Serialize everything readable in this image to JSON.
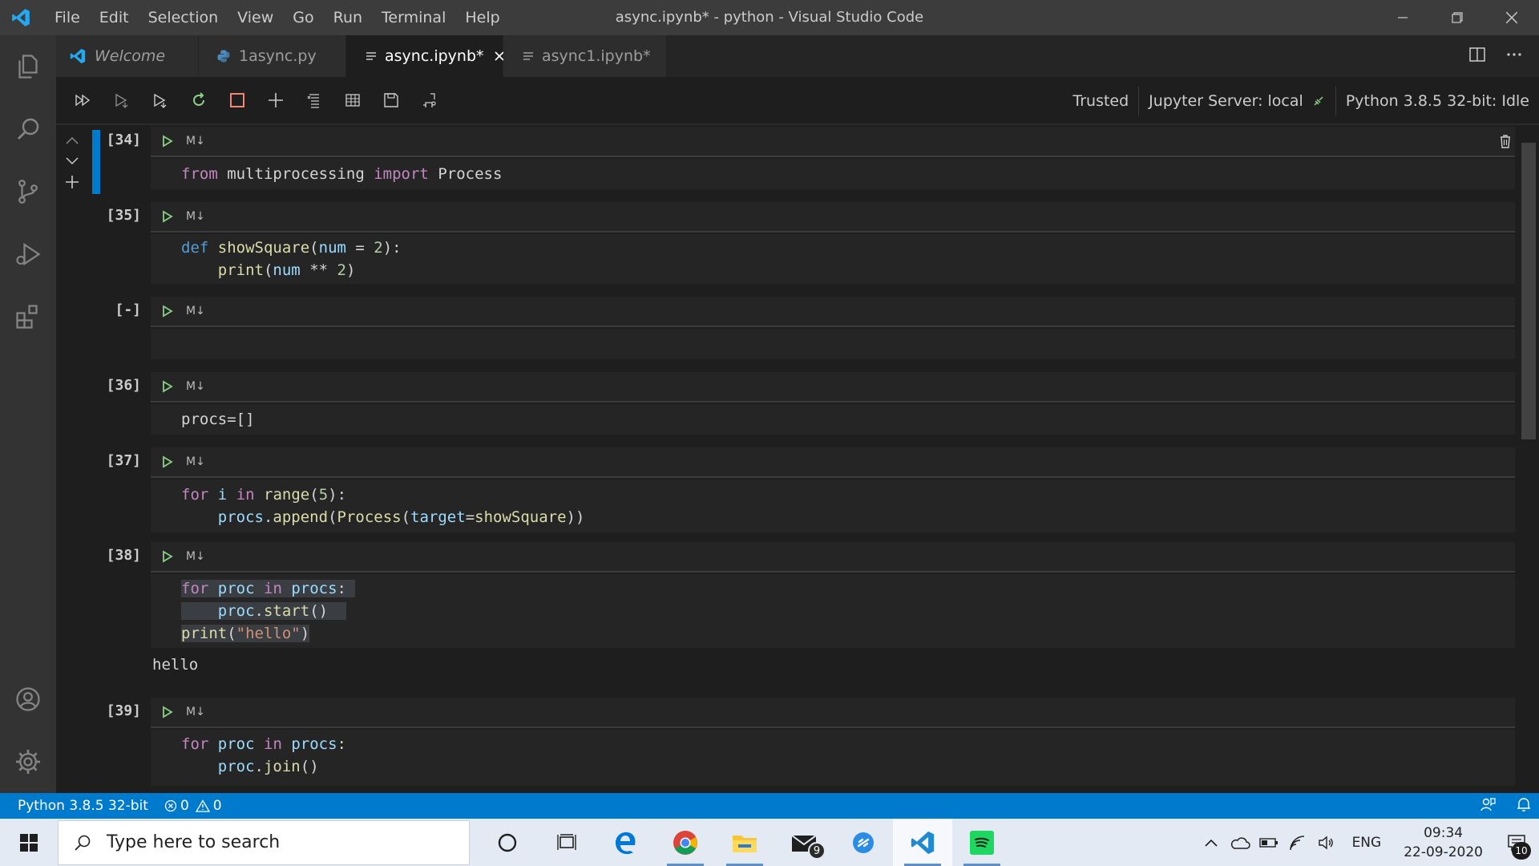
{
  "window": {
    "title": "async.ipynb* - python - Visual Studio Code",
    "menu": [
      "File",
      "Edit",
      "Selection",
      "View",
      "Go",
      "Run",
      "Terminal",
      "Help"
    ]
  },
  "tabs": [
    {
      "label": "Welcome",
      "icon": "vscode-icon",
      "italic": true,
      "active": false
    },
    {
      "label": "1async.py",
      "icon": "python-icon",
      "italic": false,
      "active": false
    },
    {
      "label": "async.ipynb*",
      "icon": "notebook-icon",
      "italic": false,
      "active": true
    },
    {
      "label": "async1.ipynb*",
      "icon": "notebook-icon",
      "italic": false,
      "active": false
    }
  ],
  "toolbar": {
    "trusted": "Trusted",
    "jupyter_server": "Jupyter Server: local",
    "kernel": "Python 3.8.5 32-bit: Idle"
  },
  "cells": [
    {
      "count": "[34]",
      "md": "M↓",
      "lines": [
        "from multiprocessing import Process"
      ]
    },
    {
      "count": "[35]",
      "md": "M↓",
      "lines": [
        "def showSquare(num = 2):",
        "    print(num ** 2)"
      ]
    },
    {
      "count": "[-]",
      "md": "M↓",
      "lines": [
        ""
      ]
    },
    {
      "count": "[36]",
      "md": "M↓",
      "lines": [
        "procs=[]"
      ]
    },
    {
      "count": "[37]",
      "md": "M↓",
      "lines": [
        "for i in range(5):",
        "    procs.append(Process(target=showSquare))"
      ]
    },
    {
      "count": "[38]",
      "md": "M↓",
      "lines": [
        "for proc in procs:",
        "    proc.start()",
        "print(\"hello\")"
      ],
      "output": "hello"
    },
    {
      "count": "[39]",
      "md": "M↓",
      "lines": [
        "for proc in procs:",
        "    proc.join()"
      ]
    }
  ],
  "statusbar": {
    "interpreter": "Python 3.8.5 32-bit",
    "errors": "0",
    "warnings": "0"
  },
  "taskbar": {
    "search_placeholder": "Type here to search",
    "mail_badge": "9",
    "language": "ENG",
    "time": "09:34",
    "date": "22-09-2020",
    "notifications": "10"
  },
  "colors": {
    "accent": "#007acc",
    "run_green": "#89d185",
    "stop_orange": "#f48771"
  }
}
